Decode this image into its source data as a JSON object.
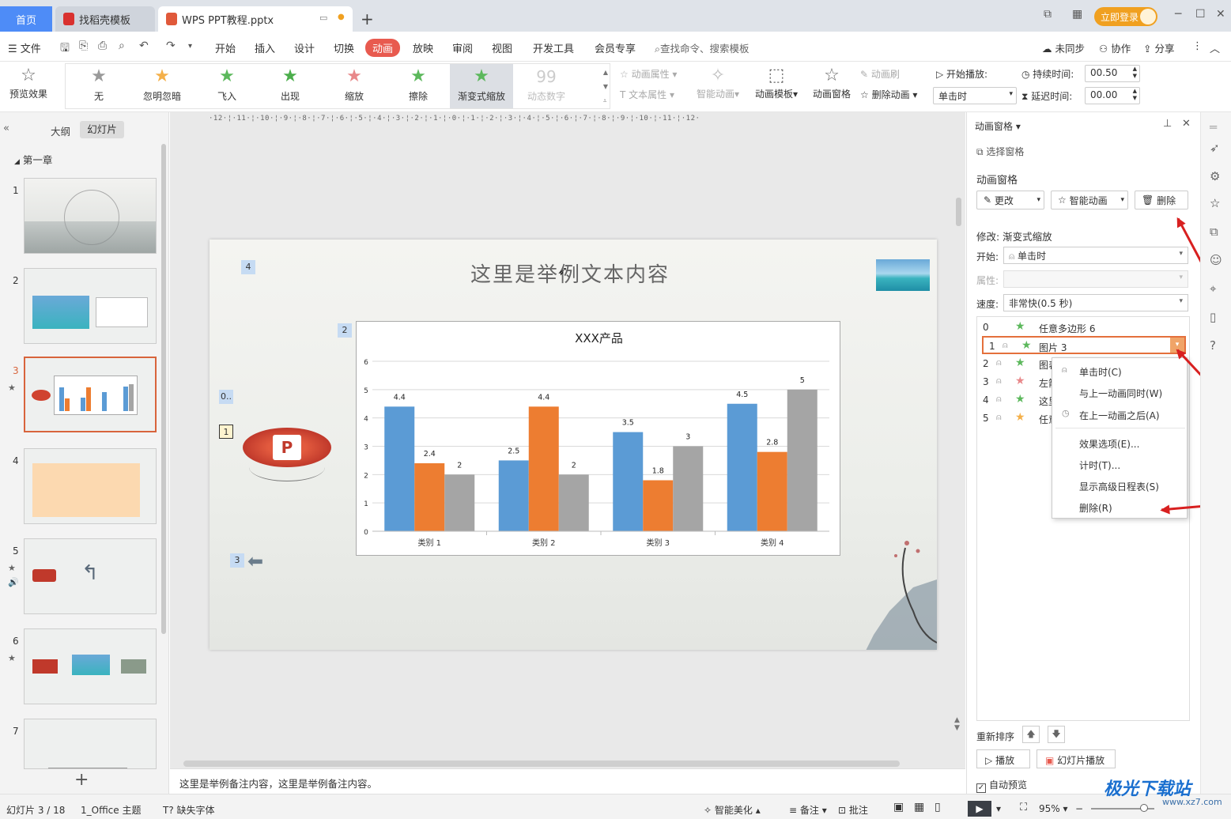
{
  "titlebar": {
    "home_tab": "首页",
    "template_tab": "找稻壳模板",
    "doc_tab": "WPS PPT教程.pptx",
    "login_button": "立即登录"
  },
  "menubar": {
    "file": "文件",
    "items": [
      "开始",
      "插入",
      "设计",
      "切换",
      "动画",
      "放映",
      "审阅",
      "视图",
      "开发工具",
      "会员专享"
    ],
    "search_placeholder": "查找命令、搜索模板",
    "sync": "未同步",
    "collab": "协作",
    "share": "分享"
  },
  "ribbon": {
    "preview_effect": "预览效果",
    "effects": [
      {
        "label": "无",
        "icon": "★",
        "color": "#9a9a9a"
      },
      {
        "label": "忽明忽暗",
        "icon": "★",
        "color": "#f4b04a"
      },
      {
        "label": "飞入",
        "icon": "★",
        "color": "#5cb85c"
      },
      {
        "label": "出现",
        "icon": "★",
        "color": "#4cae4c"
      },
      {
        "label": "缩放",
        "icon": "★",
        "color": "#e8888a"
      },
      {
        "label": "擦除",
        "icon": "★",
        "color": "#5cb85c"
      },
      {
        "label": "渐变式缩放",
        "icon": "★",
        "color": "#5cb85c"
      },
      {
        "label": "动态数字",
        "icon": "99",
        "color": "#cccccc"
      }
    ],
    "anim_props": "动画属性",
    "text_props": "文本属性",
    "smart_anim": "智能动画",
    "anim_template": "动画模板",
    "anim_pane": "动画窗格",
    "anim_brush": "动画刷",
    "delete_anim": "删除动画",
    "start_play_label": "开始播放:",
    "start_play_value": "单击时",
    "duration_label": "持续时间:",
    "duration_value": "00.50",
    "delay_label": "延迟时间:",
    "delay_value": "00.00"
  },
  "left_panel": {
    "outline_tab": "大纲",
    "slides_tab": "幻灯片",
    "chapter": "第一章",
    "slide_numbers": [
      "1",
      "2",
      "3",
      "4",
      "5",
      "6",
      "7"
    ],
    "add_slide": "+"
  },
  "slide": {
    "title": "这里是举例文本内容",
    "anim_tags": [
      "4",
      "2",
      "0..",
      "1",
      "3"
    ],
    "chart_title": "XXX产品"
  },
  "chart_data": {
    "type": "bar",
    "title": "XXX产品",
    "categories": [
      "类别 1",
      "类别 2",
      "类别 3",
      "类别 4"
    ],
    "series": [
      {
        "values": [
          4.4,
          2.5,
          3.5,
          4.5
        ],
        "color": "#5b9bd5"
      },
      {
        "values": [
          2.4,
          4.4,
          1.8,
          2.8
        ],
        "color": "#ed7d31"
      },
      {
        "values": [
          2,
          2,
          3,
          5
        ],
        "color": "#a5a5a5"
      }
    ],
    "ylim": [
      0,
      6
    ],
    "yticks": [
      0,
      1,
      2,
      3,
      4,
      5,
      6
    ],
    "grid": true
  },
  "notes": "这里是举例备注内容，这里是举例备注内容。",
  "right_pane": {
    "pane_title": "动画窗格",
    "select_pane": "选择窗格",
    "section_title": "动画窗格",
    "change_btn": "更改",
    "smart_btn": "智能动画",
    "delete_btn": "删除",
    "modify_label": "修改: 渐变式缩放",
    "start_label": "开始:",
    "start_value": "单击时",
    "prop_label": "属性:",
    "speed_label": "速度:",
    "speed_value": "非常快(0.5 秒)",
    "anim_items": [
      {
        "idx": "0",
        "name": "任意多边形 6",
        "color": "#5cb85c"
      },
      {
        "idx": "1",
        "name": "图片 3",
        "color": "#5cb85c"
      },
      {
        "idx": "2",
        "name": "图表",
        "color": "#5cb85c"
      },
      {
        "idx": "3",
        "name": "左箭",
        "color": "#e8888a"
      },
      {
        "idx": "4",
        "name": "这里",
        "color": "#5cb85c"
      },
      {
        "idx": "5",
        "name": "任意",
        "color": "#f4b04a"
      }
    ],
    "context_menu": {
      "on_click": "单击时(C)",
      "with_prev": "与上一动画同时(W)",
      "after_prev": "在上一动画之后(A)",
      "effect_options": "效果选项(E)...",
      "timing": "计时(T)...",
      "show_timeline": "显示高级日程表(S)",
      "delete": "删除(R)"
    },
    "reorder_label": "重新排序",
    "play_btn": "播放",
    "slideshow_btn": "幻灯片播放",
    "auto_preview": "自动预览"
  },
  "statusbar": {
    "slide_count": "幻灯片 3 / 18",
    "theme": "1_Office 主题",
    "missing_font": "缺失字体",
    "smart_beautify": "智能美化",
    "notes": "备注",
    "comments": "批注",
    "zoom": "95%"
  },
  "watermark": {
    "brand": "极光下载站",
    "url": "www.xz7.com"
  }
}
